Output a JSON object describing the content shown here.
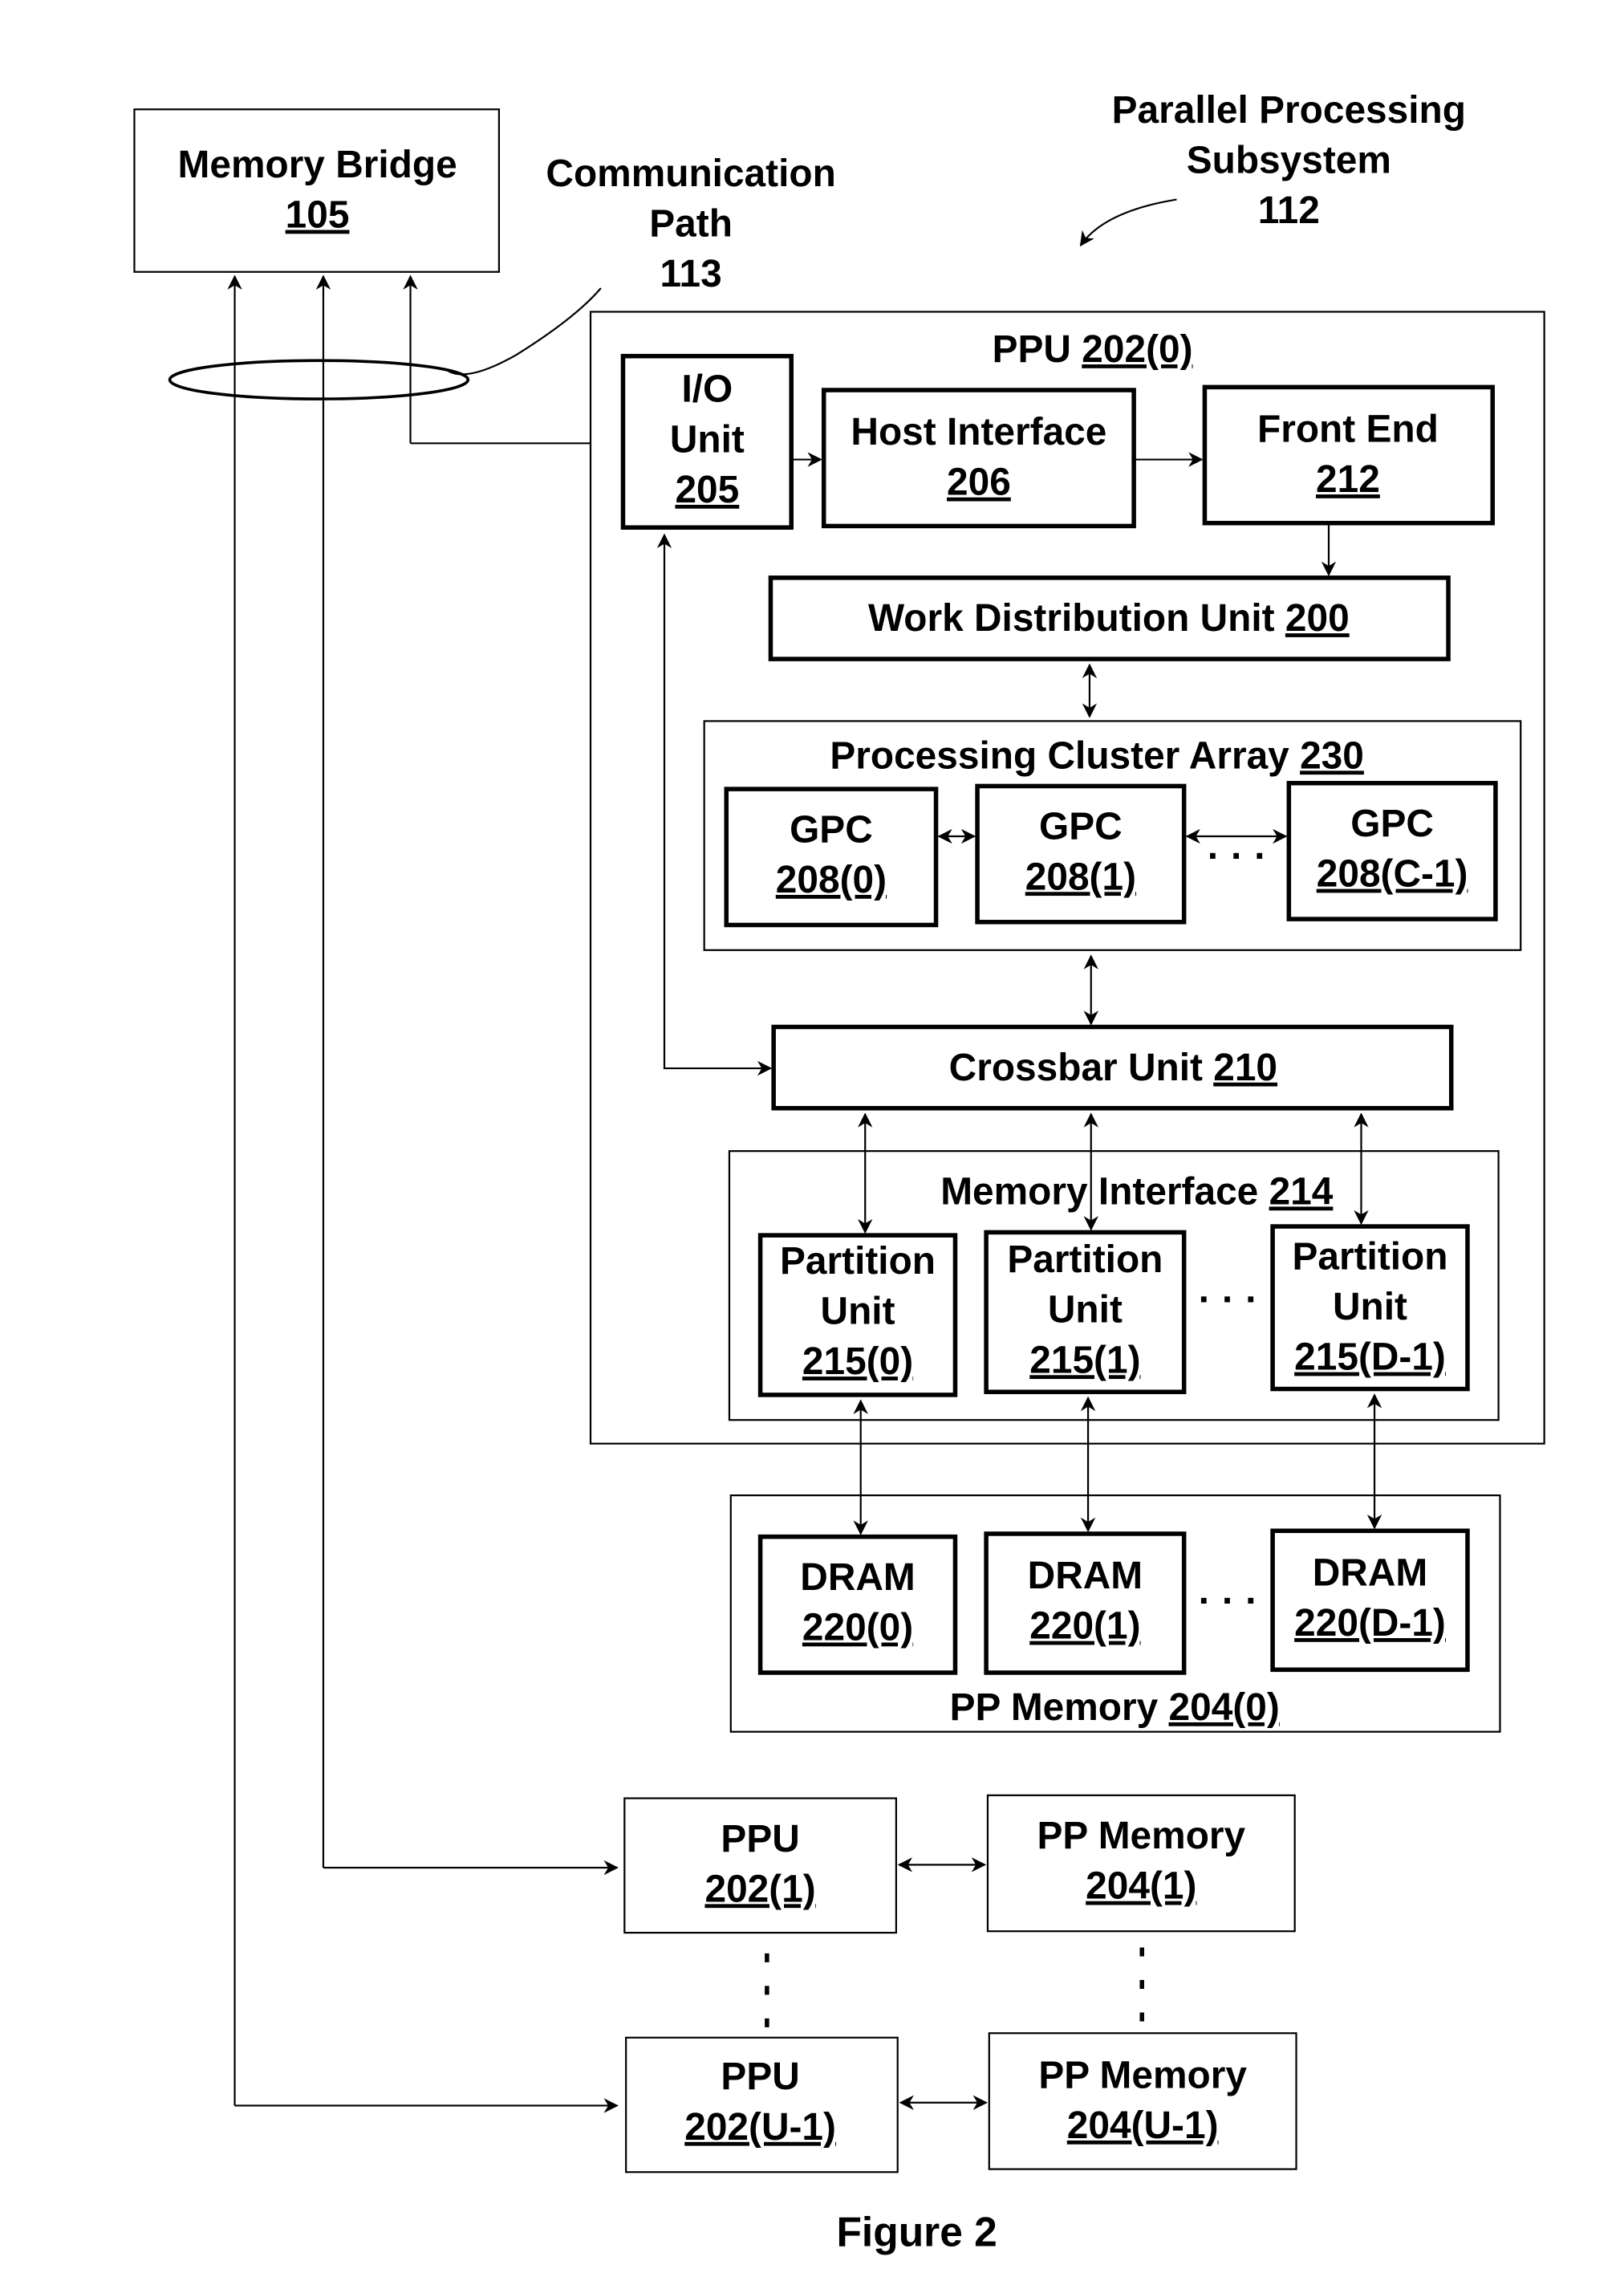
{
  "figure": {
    "caption": "Figure 2",
    "callouts": {
      "subsystem": {
        "line1": "Parallel Processing",
        "line2": "Subsystem",
        "ref": "112"
      },
      "comm_path": {
        "line1": "Communication",
        "line2": "Path",
        "ref": "113"
      }
    },
    "memory_bridge": {
      "label": "Memory Bridge",
      "ref": "105"
    },
    "ppu0": {
      "label": "PPU ",
      "ref": "202(0)"
    },
    "io_unit": {
      "line1": "I/O",
      "line2": "Unit",
      "ref": "205"
    },
    "host_interface": {
      "label": "Host Interface",
      "ref": "206"
    },
    "front_end": {
      "label": "Front End",
      "ref": "212"
    },
    "work_distribution": {
      "label": "Work Distribution Unit ",
      "ref": "200"
    },
    "pca": {
      "label": "Processing Cluster Array ",
      "ref": "230"
    },
    "gpcs": [
      {
        "label": "GPC",
        "ref": "208(0)"
      },
      {
        "label": "GPC",
        "ref": "208(1)"
      },
      {
        "label": "GPC",
        "ref": "208(C-1)"
      }
    ],
    "crossbar": {
      "label": "Crossbar Unit ",
      "ref": "210"
    },
    "memory_interface": {
      "label": "Memory Interface ",
      "ref": "214"
    },
    "partition_units": [
      {
        "line1": "Partition",
        "line2": "Unit",
        "ref": "215(0)"
      },
      {
        "line1": "Partition",
        "line2": "Unit",
        "ref": "215(1)"
      },
      {
        "line1": "Partition",
        "line2": "Unit",
        "ref": "215(D-1)"
      }
    ],
    "pp_memory0": {
      "label": "PP Memory ",
      "ref": "204(0)"
    },
    "drams": [
      {
        "label": "DRAM",
        "ref": "220(0)"
      },
      {
        "label": "DRAM",
        "ref": "220(1)"
      },
      {
        "label": "DRAM",
        "ref": "220(D-1)"
      }
    ],
    "ppu_others": [
      {
        "label": "PPU",
        "ref": "202(1)"
      },
      {
        "label": "PPU",
        "ref": "202(U-1)"
      }
    ],
    "pp_memory_others": [
      {
        "label": "PP Memory",
        "ref": "204(1)"
      },
      {
        "label": "PP Memory",
        "ref": "204(U-1)"
      }
    ],
    "ellipsis": "· · ·"
  }
}
